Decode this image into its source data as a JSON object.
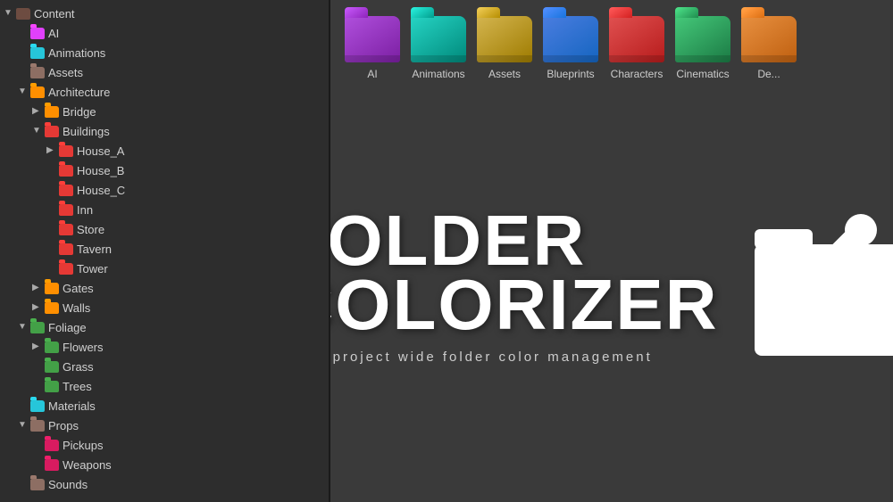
{
  "leftPanel": {
    "title": "Content",
    "treeItems": [
      {
        "label": "AI",
        "indent": 1,
        "folderColor": "folder-pink",
        "arrow": "empty",
        "id": "ai"
      },
      {
        "label": "Animations",
        "indent": 1,
        "folderColor": "folder-cyan",
        "arrow": "empty",
        "id": "animations"
      },
      {
        "label": "Assets",
        "indent": 1,
        "folderColor": "folder-brown",
        "arrow": "empty",
        "id": "assets"
      },
      {
        "label": "Architecture",
        "indent": 1,
        "folderColor": "folder-orange",
        "arrow": "down",
        "id": "architecture"
      },
      {
        "label": "Bridge",
        "indent": 2,
        "folderColor": "folder-orange",
        "arrow": "right",
        "id": "bridge"
      },
      {
        "label": "Buildings",
        "indent": 2,
        "folderColor": "folder-red",
        "arrow": "down",
        "id": "buildings"
      },
      {
        "label": "House_A",
        "indent": 3,
        "folderColor": "folder-red",
        "arrow": "right",
        "id": "house-a"
      },
      {
        "label": "House_B",
        "indent": 3,
        "folderColor": "folder-red",
        "arrow": "empty",
        "id": "house-b"
      },
      {
        "label": "House_C",
        "indent": 3,
        "folderColor": "folder-red",
        "arrow": "empty",
        "id": "house-c"
      },
      {
        "label": "Inn",
        "indent": 3,
        "folderColor": "folder-red",
        "arrow": "empty",
        "id": "inn"
      },
      {
        "label": "Store",
        "indent": 3,
        "folderColor": "folder-red",
        "arrow": "empty",
        "id": "store"
      },
      {
        "label": "Tavern",
        "indent": 3,
        "folderColor": "folder-red",
        "arrow": "empty",
        "id": "tavern"
      },
      {
        "label": "Tower",
        "indent": 3,
        "folderColor": "folder-red",
        "arrow": "empty",
        "id": "tower"
      },
      {
        "label": "Gates",
        "indent": 2,
        "folderColor": "folder-orange",
        "arrow": "right",
        "id": "gates"
      },
      {
        "label": "Walls",
        "indent": 2,
        "folderColor": "folder-orange",
        "arrow": "right",
        "id": "walls"
      },
      {
        "label": "Foliage",
        "indent": 1,
        "folderColor": "folder-green",
        "arrow": "down",
        "id": "foliage"
      },
      {
        "label": "Flowers",
        "indent": 2,
        "folderColor": "folder-green",
        "arrow": "right",
        "id": "flowers"
      },
      {
        "label": "Grass",
        "indent": 2,
        "folderColor": "folder-green",
        "arrow": "empty",
        "id": "grass"
      },
      {
        "label": "Trees",
        "indent": 2,
        "folderColor": "folder-green",
        "arrow": "empty",
        "id": "trees"
      },
      {
        "label": "Materials",
        "indent": 1,
        "folderColor": "folder-cyan",
        "arrow": "empty",
        "id": "materials"
      },
      {
        "label": "Props",
        "indent": 1,
        "folderColor": "folder-brown",
        "arrow": "down",
        "id": "props"
      },
      {
        "label": "Pickups",
        "indent": 2,
        "folderColor": "folder-magenta",
        "arrow": "empty",
        "id": "pickups"
      },
      {
        "label": "Weapons",
        "indent": 2,
        "folderColor": "folder-magenta",
        "arrow": "empty",
        "id": "weapons"
      },
      {
        "label": "Sounds",
        "indent": 1,
        "folderColor": "folder-brown",
        "arrow": "empty",
        "id": "sounds"
      }
    ]
  },
  "rightPanel": {
    "folders": [
      {
        "color": "f3d-purple",
        "label": "AI"
      },
      {
        "color": "f3d-teal",
        "label": "Animations"
      },
      {
        "color": "f3d-gold",
        "label": "Assets"
      },
      {
        "color": "f3d-blue",
        "label": "Blueprints"
      },
      {
        "color": "f3d-red",
        "label": "Characters"
      },
      {
        "color": "f3d-green",
        "label": "Cinematics"
      },
      {
        "color": "f3d-orange",
        "label": "De..."
      }
    ],
    "promoTitle1": "FOLDER",
    "promoTitle2": "COLORIZER",
    "promoSubtitle": "quick project wide folder color management"
  }
}
